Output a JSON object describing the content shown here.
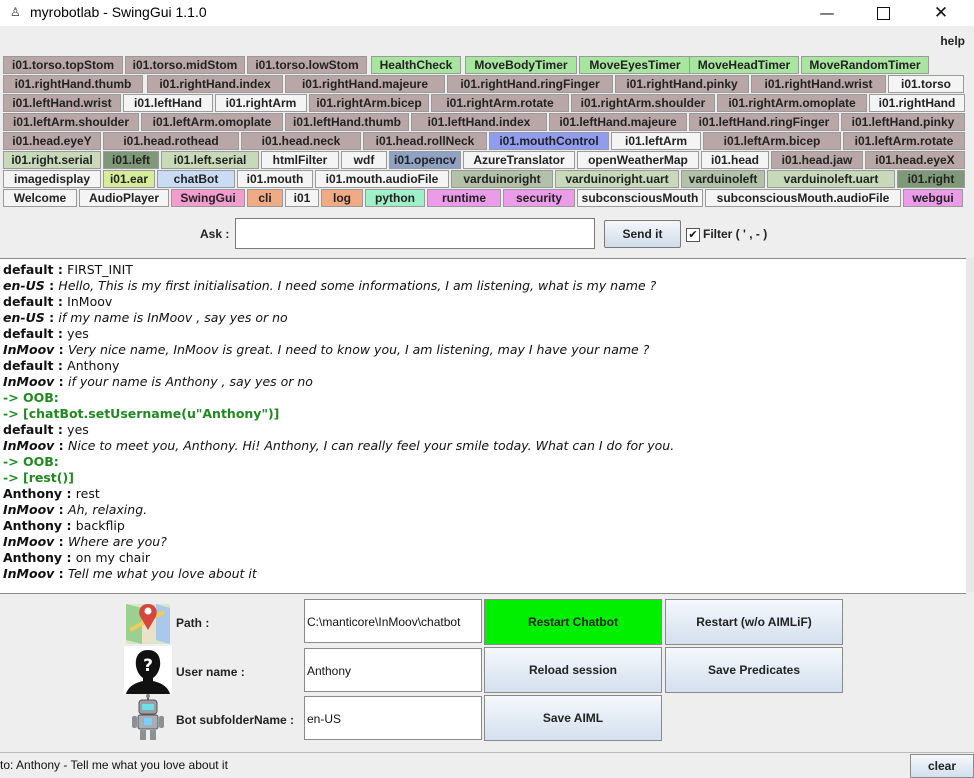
{
  "window": {
    "title": "myrobotlab - SwingGui 1.1.0",
    "minimize": "—",
    "close": "✕"
  },
  "menu": {
    "help": "help"
  },
  "tab_rows": [
    [
      {
        "label": "i01.torso.topStom",
        "color": "#b9a7a7"
      },
      {
        "label": "i01.torso.midStom",
        "color": "#b9a7a7"
      },
      {
        "label": "i01.torso.lowStom",
        "color": "#b9a7a7"
      },
      {
        "label": "HealthCheck",
        "color": "#a8e6a0"
      },
      {
        "label": "MoveBodyTimer",
        "color": "#a8e6a0"
      },
      {
        "label": "MoveEyesTimer",
        "color": "#a8e6a0"
      },
      {
        "label": "MoveHeadTimer",
        "color": "#a8e6a0"
      },
      {
        "label": "MoveRandomTimer",
        "color": "#a8e6a0"
      }
    ],
    [
      {
        "label": "i01.rightHand.thumb",
        "color": "#b9a7a7"
      },
      {
        "label": "i01.rightHand.index",
        "color": "#b9a7a7"
      },
      {
        "label": "i01.rightHand.majeure",
        "color": "#b9a7a7"
      },
      {
        "label": "i01.rightHand.ringFinger",
        "color": "#b9a7a7"
      },
      {
        "label": "i01.rightHand.pinky",
        "color": "#b9a7a7"
      },
      {
        "label": "i01.rightHand.wrist",
        "color": "#b9a7a7"
      },
      {
        "label": "i01.torso",
        "color": "#f4f4f4"
      }
    ],
    [
      {
        "label": "i01.leftHand.wrist",
        "color": "#b9a7a7"
      },
      {
        "label": "i01.leftHand",
        "color": "#f4f4f4"
      },
      {
        "label": "i01.rightArm",
        "color": "#f4f4f4"
      },
      {
        "label": "i01.rightArm.bicep",
        "color": "#b9a7a7"
      },
      {
        "label": "i01.rightArm.rotate",
        "color": "#b9a7a7"
      },
      {
        "label": "i01.rightArm.shoulder",
        "color": "#b9a7a7"
      },
      {
        "label": "i01.rightArm.omoplate",
        "color": "#b9a7a7"
      },
      {
        "label": "i01.rightHand",
        "color": "#f4f4f4"
      }
    ],
    [
      {
        "label": "i01.leftArm.shoulder",
        "color": "#b9a7a7"
      },
      {
        "label": "i01.leftArm.omoplate",
        "color": "#b9a7a7"
      },
      {
        "label": "i01.leftHand.thumb",
        "color": "#b9a7a7"
      },
      {
        "label": "i01.leftHand.index",
        "color": "#b9a7a7"
      },
      {
        "label": "i01.leftHand.majeure",
        "color": "#b9a7a7"
      },
      {
        "label": "i01.leftHand.ringFinger",
        "color": "#b9a7a7"
      },
      {
        "label": "i01.leftHand.pinky",
        "color": "#b9a7a7"
      }
    ],
    [
      {
        "label": "i01.head.eyeY",
        "color": "#b9a7a7"
      },
      {
        "label": "i01.head.rothead",
        "color": "#b9a7a7"
      },
      {
        "label": "i01.head.neck",
        "color": "#b9a7a7"
      },
      {
        "label": "i01.head.rollNeck",
        "color": "#b9a7a7"
      },
      {
        "label": "i01.mouthControl",
        "color": "#8f9cf0"
      },
      {
        "label": "i01.leftArm",
        "color": "#f4f4f4"
      },
      {
        "label": "i01.leftArm.bicep",
        "color": "#b9a7a7"
      },
      {
        "label": "i01.leftArm.rotate",
        "color": "#b9a7a7"
      }
    ],
    [
      {
        "label": "i01.right.serial",
        "color": "#c7d9b9"
      },
      {
        "label": "i01.left",
        "color": "#7f9978"
      },
      {
        "label": "i01.left.serial",
        "color": "#c7d9b9"
      },
      {
        "label": "htmlFilter",
        "color": "#f4f4f4"
      },
      {
        "label": "wdf",
        "color": "#f4f4f4"
      },
      {
        "label": "i01.opencv",
        "color": "#8fa2c4"
      },
      {
        "label": "AzureTranslator",
        "color": "#f4f4f4"
      },
      {
        "label": "openWeatherMap",
        "color": "#f4f4f4"
      },
      {
        "label": "i01.head",
        "color": "#f4f4f4"
      },
      {
        "label": "i01.head.jaw",
        "color": "#b9a7a7"
      },
      {
        "label": "i01.head.eyeX",
        "color": "#b9a7a7"
      }
    ],
    [
      {
        "label": "imagedisplay",
        "color": "#f4f4f4"
      },
      {
        "label": "i01.ear",
        "color": "#d6ec98"
      },
      {
        "label": "chatBot",
        "color": "#c9dcf4"
      },
      {
        "label": "i01.mouth",
        "color": "#f4f4f4"
      },
      {
        "label": "i01.mouth.audioFile",
        "color": "#f4f4f4"
      },
      {
        "label": "varduinoright",
        "color": "#b2c2a8"
      },
      {
        "label": "varduinoright.uart",
        "color": "#c7d9b9"
      },
      {
        "label": "varduinoleft",
        "color": "#b2c2a8"
      },
      {
        "label": "varduinoleft.uart",
        "color": "#c7d9b9"
      },
      {
        "label": "i01.right",
        "color": "#7f9978"
      }
    ],
    [
      {
        "label": "Welcome",
        "color": "#f4f4f4"
      },
      {
        "label": "AudioPlayer",
        "color": "#f4f4f4"
      },
      {
        "label": "SwingGui",
        "color": "#f29ccf"
      },
      {
        "label": "cli",
        "color": "#f0ab85"
      },
      {
        "label": "i01",
        "color": "#f4f4f4"
      },
      {
        "label": "log",
        "color": "#f0ab85"
      },
      {
        "label": "python",
        "color": "#9ff0c8"
      },
      {
        "label": "runtime",
        "color": "#ea9ce8"
      },
      {
        "label": "security",
        "color": "#ea9ce8"
      },
      {
        "label": "subconsciousMouth",
        "color": "#f4f4f4"
      },
      {
        "label": "subconsciousMouth.audioFile",
        "color": "#f4f4f4"
      },
      {
        "label": "webgui",
        "color": "#ea9ce8"
      }
    ]
  ],
  "ask": {
    "label": "Ask :",
    "value": "",
    "send": "Send it",
    "filter_checked": "✔",
    "filter_label": "Filter ( ' , - )"
  },
  "chat": [
    {
      "who": "default",
      "msg": "FIRST_INIT",
      "style": "normal"
    },
    {
      "who": "en-US",
      "msg": "Hello, This is my first initialisation. I need some informations, I am listening, what is my name ?",
      "style": "italic"
    },
    {
      "who": "default",
      "msg": "InMoov",
      "style": "normal"
    },
    {
      "who": "en-US",
      "msg": "if my name is InMoov , say yes or no",
      "style": "italic"
    },
    {
      "who": "default",
      "msg": "yes",
      "style": "normal"
    },
    {
      "who": "InMoov",
      "msg": "Very nice name, InMoov is great. I need to know you, I am listening, may I have your name ?",
      "style": "italic"
    },
    {
      "who": "default",
      "msg": "Anthony",
      "style": "normal"
    },
    {
      "who": "InMoov",
      "msg": "if your name is Anthony , say yes or no",
      "style": "italic"
    },
    {
      "who": "",
      "msg": "-> OOB:",
      "style": "oob"
    },
    {
      "who": "",
      "msg": "-> [chatBot.setUsername(u\"Anthony\")]",
      "style": "oob"
    },
    {
      "who": "default",
      "msg": "yes",
      "style": "normal"
    },
    {
      "who": "InMoov",
      "msg": "Nice to meet you, Anthony. Hi! Anthony, I can really feel your smile today. What can I do for you.",
      "style": "italic"
    },
    {
      "who": "",
      "msg": "-> OOB:",
      "style": "oob"
    },
    {
      "who": "",
      "msg": "-> [rest()]",
      "style": "oob"
    },
    {
      "who": "Anthony",
      "msg": "rest",
      "style": "normal"
    },
    {
      "who": "InMoov",
      "msg": "Ah, relaxing.",
      "style": "italic"
    },
    {
      "who": "Anthony",
      "msg": "backflip",
      "style": "normal"
    },
    {
      "who": "InMoov",
      "msg": "Where are you?",
      "style": "italic"
    },
    {
      "who": "Anthony",
      "msg": "on my chair",
      "style": "normal"
    },
    {
      "who": "InMoov",
      "msg": "Tell me what you love about it",
      "style": "italic"
    }
  ],
  "panel": {
    "path_label": "Path :",
    "path_value": "C:\\manticore\\InMoov\\chatbot",
    "username_label": "User name :",
    "username_value": "Anthony",
    "subfolder_label": "Bot subfolderName :",
    "subfolder_value": "en-US",
    "restart_chatbot": "Restart Chatbot",
    "restart_wo": "Restart (w/o AIMLiF)",
    "reload_session": "Reload session",
    "save_predicates": "Save Predicates",
    "save_aiml": "Save AIML"
  },
  "status": {
    "text": "to: Anthony - Tell me what you love about it",
    "clear": "clear"
  }
}
